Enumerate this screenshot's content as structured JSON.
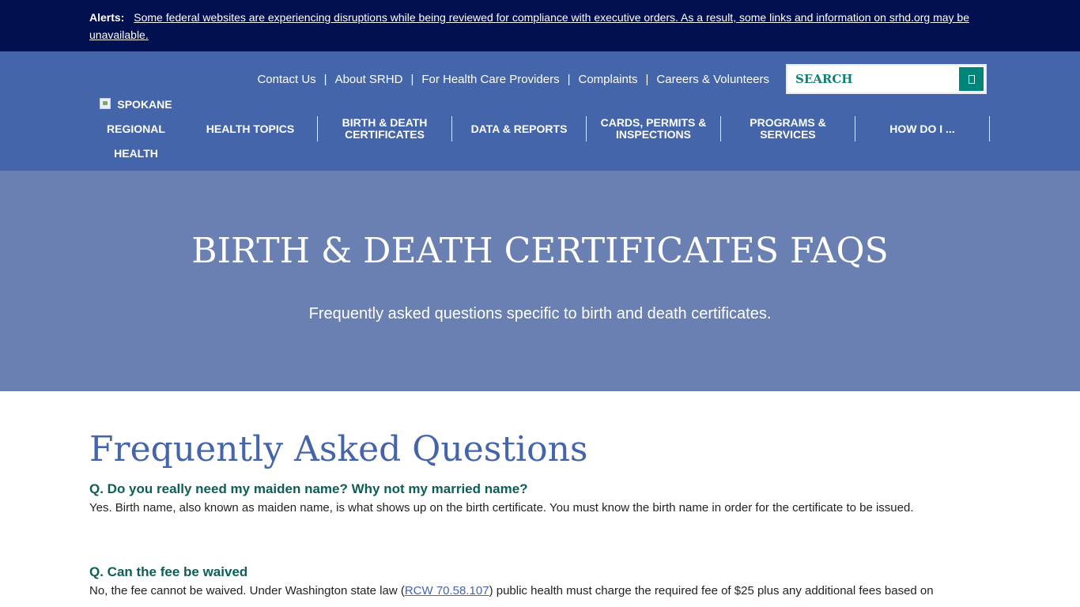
{
  "alert": {
    "label": "Alerts:",
    "message": "Some federal websites are experiencing disruptions while being reviewed for compliance with executive orders. As a result, some links and information on srhd.org may be unavailable."
  },
  "logo": {
    "lines": [
      "SPOKANE",
      "REGIONAL",
      "HEALTH"
    ]
  },
  "utility_nav": [
    {
      "label": "Contact Us"
    },
    {
      "label": "About SRHD"
    },
    {
      "label": "For Health Care Providers"
    },
    {
      "label": "Complaints"
    },
    {
      "label": "Careers & Volunteers"
    }
  ],
  "utility_separator": "|",
  "search": {
    "placeholder": "SEARCH",
    "value": "",
    "button_icon": "search-icon"
  },
  "main_nav": [
    {
      "label": "HEALTH TOPICS"
    },
    {
      "label": "BIRTH & DEATH CERTIFICATES"
    },
    {
      "label": "DATA & REPORTS"
    },
    {
      "label": "CARDS, PERMITS & INSPECTIONS"
    },
    {
      "label": "PROGRAMS & SERVICES"
    },
    {
      "label": "HOW DO I ..."
    }
  ],
  "hero": {
    "title": "BIRTH & DEATH CERTIFICATES FAQS",
    "subtitle": "Frequently asked questions specific to birth and death certificates."
  },
  "faq": {
    "heading": "Frequently Asked Questions",
    "items": [
      {
        "question": "Q. Do you really need my maiden name? Why not my married name?",
        "answer": "Yes. Birth name, also known as maiden name, is what shows up on the birth certificate. You must know the birth name in order for the certificate to be issued."
      },
      {
        "question": "Q. Can the fee be waived",
        "answer_before": "No, the fee cannot be waived. Under Washington state law (",
        "answer_link": "RCW 70.58.107",
        "answer_after": ") public health must charge the required fee of $25 plus any additional fees based on"
      }
    ]
  },
  "colors": {
    "alert_bg": "#001051",
    "header_bg": "#4465aa",
    "hero_bg": "#6a80b2",
    "heading": "#4465aa",
    "question": "#0d5e58",
    "search_button": "#00857a"
  }
}
